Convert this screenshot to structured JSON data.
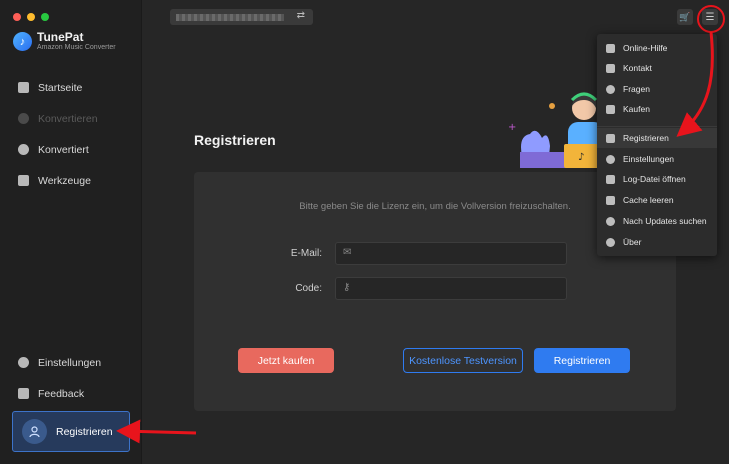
{
  "app": {
    "name": "TunePat",
    "subtitle": "Amazon Music Converter"
  },
  "sidebar": {
    "items": [
      {
        "label": "Startseite",
        "icon": "home-icon",
        "enabled": true
      },
      {
        "label": "Konvertieren",
        "icon": "convert-icon",
        "enabled": false
      },
      {
        "label": "Konvertiert",
        "icon": "clock-icon",
        "enabled": true
      },
      {
        "label": "Werkzeuge",
        "icon": "toolbox-icon",
        "enabled": true
      }
    ],
    "bottom": [
      {
        "label": "Einstellungen",
        "icon": "gear-icon"
      },
      {
        "label": "Feedback",
        "icon": "mail-icon"
      }
    ],
    "register_label": "Registrieren"
  },
  "header": {
    "switch_icon": "⇄"
  },
  "main": {
    "title": "Registrieren",
    "hint": "Bitte geben Sie die Lizenz ein, um die Vollversion freizuschalten.",
    "email_label": "E-Mail:",
    "code_label": "Code:",
    "buy_label": "Jetzt kaufen",
    "trial_label": "Kostenlose Testversion",
    "register_label": "Registrieren"
  },
  "menu": {
    "items": [
      {
        "label": "Online-Hilfe",
        "icon": "graduation-cap-icon"
      },
      {
        "label": "Kontakt",
        "icon": "phone-icon"
      },
      {
        "label": "Fragen",
        "icon": "question-icon"
      },
      {
        "label": "Kaufen",
        "icon": "cart-icon"
      },
      {
        "label": "Registrieren",
        "icon": "user-key-icon",
        "highlighted": true
      },
      {
        "label": "Einstellungen",
        "icon": "gear-icon"
      },
      {
        "label": "Log-Datei öffnen",
        "icon": "file-icon"
      },
      {
        "label": "Cache leeren",
        "icon": "broom-icon"
      },
      {
        "label": "Nach Updates suchen",
        "icon": "refresh-icon"
      },
      {
        "label": "Über",
        "icon": "info-icon"
      }
    ]
  },
  "colors": {
    "accent": "#2f7bf0",
    "buy": "#e8695e",
    "annotation": "#e8141c"
  }
}
